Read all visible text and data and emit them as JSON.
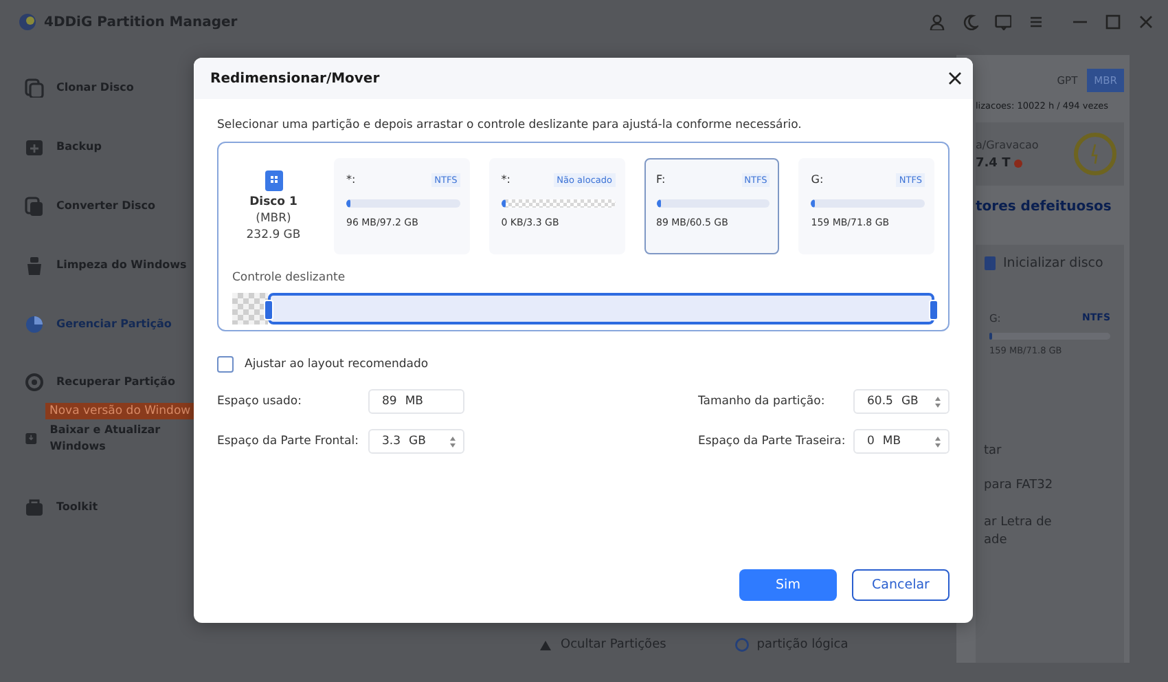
{
  "app": {
    "title": "4DDiG Partition Manager"
  },
  "sidebar": {
    "items": [
      {
        "label": "Clonar Disco",
        "selected": false
      },
      {
        "label": "Backup",
        "selected": false
      },
      {
        "label": "Converter Disco",
        "selected": false
      },
      {
        "label": "Limpeza do Windows",
        "selected": false
      },
      {
        "label": "Gerenciar Partição",
        "selected": true
      },
      {
        "label": "Recuperar Partição",
        "selected": false
      },
      {
        "label": "Baixar e Atualizar Windows",
        "selected": false
      },
      {
        "label": "Toolkit",
        "selected": false
      }
    ],
    "badge": "Nova versão do Window"
  },
  "disk_panel": {
    "style_buttons": [
      {
        "label": "GPT",
        "selected": false
      },
      {
        "label": "MBR",
        "selected": true
      }
    ],
    "stats": "lizacoes: 10022 h / 494 vezes",
    "health_label": "a/Gravacao",
    "health_value": "7.4 T",
    "link": "tores defeituosos",
    "action": "Inicializar disco",
    "partition": {
      "name": "G:",
      "fs": "NTFS",
      "usage": "159 MB/71.8 GB",
      "level": 0.02
    },
    "menu": [
      "tar",
      "para FAT32",
      "ar Letra de ade"
    ],
    "bottom_actions": [
      "Ocultar Partições",
      "partição lógica"
    ]
  },
  "dialog": {
    "title": "Redimensionar/Mover",
    "instruction": "Selecionar uma partição e depois arrastar o controle deslizante para ajustá-la conforme necessário.",
    "disk": {
      "name": "Disco 1",
      "type": "(MBR)",
      "size": "232.9 GB"
    },
    "partitions": [
      {
        "name": "*:",
        "fs": "NTFS",
        "usage": "96 MB/97.2 GB",
        "level": 0.02,
        "kind": "allocated",
        "selected": false
      },
      {
        "name": "*:",
        "fs": "Não alocado",
        "usage": "0 KB/3.3 GB",
        "level": 0.02,
        "kind": "unallocated",
        "selected": false
      },
      {
        "name": "F:",
        "fs": "NTFS",
        "usage": "89 MB/60.5 GB",
        "level": 0.02,
        "kind": "allocated",
        "selected": true
      },
      {
        "name": "G:",
        "fs": "NTFS",
        "usage": "159 MB/71.8 GB",
        "level": 0.02,
        "kind": "allocated",
        "selected": false
      }
    ],
    "slider": {
      "label": "Controle deslizante",
      "level": 0.95
    },
    "recommended_layout": {
      "label": "Ajustar ao layout recomendado",
      "checked": false
    },
    "fields": [
      {
        "label": "Espaço usado:",
        "value": "89",
        "unit": "MB",
        "kind": "text"
      },
      {
        "label": "Tamanho da partição:",
        "value": "60.5",
        "unit": "GB",
        "kind": "spinner"
      },
      {
        "label": "Espaço da Parte Frontal:",
        "value": "3.3",
        "unit": "GB",
        "kind": "spinner"
      },
      {
        "label": "Espaço da Parte Traseira:",
        "value": "0",
        "unit": "MB",
        "kind": "spinner"
      }
    ],
    "buttons": [
      {
        "label": "Sim",
        "kind": "primary"
      },
      {
        "label": "Cancelar",
        "kind": "secondary"
      }
    ]
  }
}
